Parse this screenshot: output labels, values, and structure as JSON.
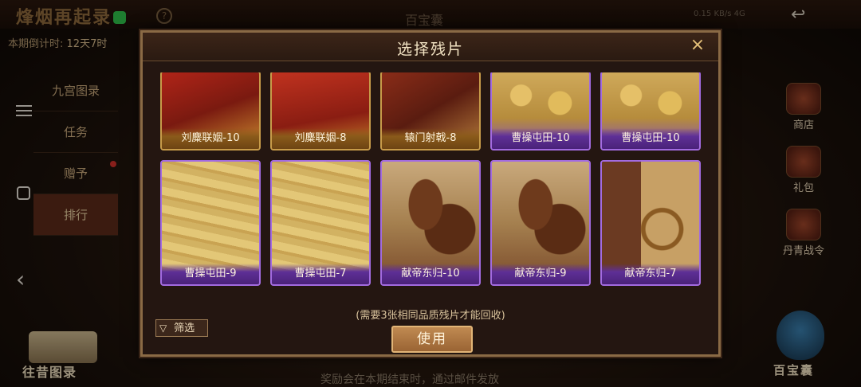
{
  "background": {
    "title": "烽烟再起录",
    "center_title": "百宝囊",
    "status": "0.15 KB/s 4G",
    "countdown_label": "本期倒计时:",
    "countdown_value": "12天7时",
    "side_menu": [
      {
        "label": "九宫图录"
      },
      {
        "label": "任务"
      },
      {
        "label": "赠予"
      },
      {
        "label": "排行"
      }
    ],
    "right_menu": [
      {
        "label": "商店",
        "icon": "chest-icon"
      },
      {
        "label": "礼包",
        "icon": "gift-icon"
      },
      {
        "label": "丹青战令",
        "icon": "pass-icon"
      }
    ],
    "bottom_left_label": "往昔图录",
    "bottom_right_label": "百宝囊",
    "bottom_hint": "奖励会在本期结束时，通过邮件发放"
  },
  "modal": {
    "title": "选择残片",
    "close_icon": "×",
    "notice": "(需要3张相同品质残片才能回收)",
    "filter_label": "筛选",
    "filter_icon": "funnel-icon",
    "use_label": "使用",
    "cards": [
      {
        "label": "刘麋联姻-10",
        "rarity": "gold"
      },
      {
        "label": "刘麋联姻-8",
        "rarity": "gold"
      },
      {
        "label": "辕门射戟-8",
        "rarity": "gold"
      },
      {
        "label": "曹操屯田-10",
        "rarity": "purple"
      },
      {
        "label": "曹操屯田-10",
        "rarity": "purple"
      },
      {
        "label": "曹操屯田-9",
        "rarity": "purple"
      },
      {
        "label": "曹操屯田-7",
        "rarity": "purple"
      },
      {
        "label": "献帝东归-10",
        "rarity": "purple"
      },
      {
        "label": "献帝东归-9",
        "rarity": "purple"
      },
      {
        "label": "献帝东归-7",
        "rarity": "purple"
      }
    ]
  },
  "colors": {
    "gold_frame": "#c79b49",
    "purple_frame": "#a26be0",
    "accent": "#e6c27a"
  }
}
